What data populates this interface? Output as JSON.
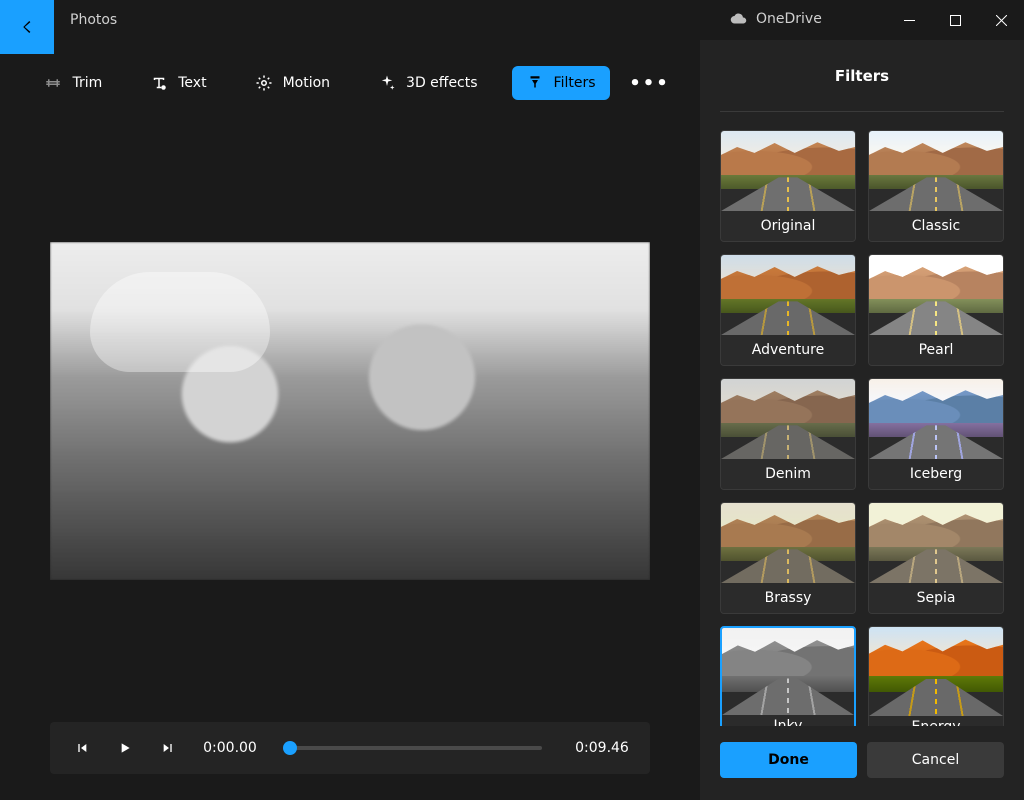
{
  "app": {
    "title": "Photos"
  },
  "cloud": {
    "label": "OneDrive"
  },
  "toolbar": {
    "trim": "Trim",
    "text": "Text",
    "motion": "Motion",
    "effects3d": "3D effects",
    "filters": "Filters"
  },
  "player": {
    "current": "0:00.00",
    "duration": "0:09.46"
  },
  "side": {
    "title": "Filters",
    "done": "Done",
    "cancel": "Cancel",
    "selected": "Inky",
    "items": [
      {
        "name": "Original",
        "css": "none"
      },
      {
        "name": "Classic",
        "css": "saturate(0.8) contrast(1.1)"
      },
      {
        "name": "Adventure",
        "css": "saturate(1.3) brightness(0.95)"
      },
      {
        "name": "Pearl",
        "css": "brightness(1.2) saturate(0.7)"
      },
      {
        "name": "Denim",
        "css": "saturate(0.6) brightness(0.9) sepia(0.1)"
      },
      {
        "name": "Iceberg",
        "css": "hue-rotate(190deg) saturate(0.7) brightness(1.05)"
      },
      {
        "name": "Brassy",
        "css": "sepia(0.4) saturate(1.1) brightness(0.9)"
      },
      {
        "name": "Sepia",
        "css": "grayscale(0.4) sepia(0.5) brightness(0.95)"
      },
      {
        "name": "Inky",
        "css": "grayscale(1) contrast(1.1)"
      },
      {
        "name": "Energy",
        "css": "saturate(1.8) contrast(1.05) brightness(0.95)"
      }
    ]
  }
}
